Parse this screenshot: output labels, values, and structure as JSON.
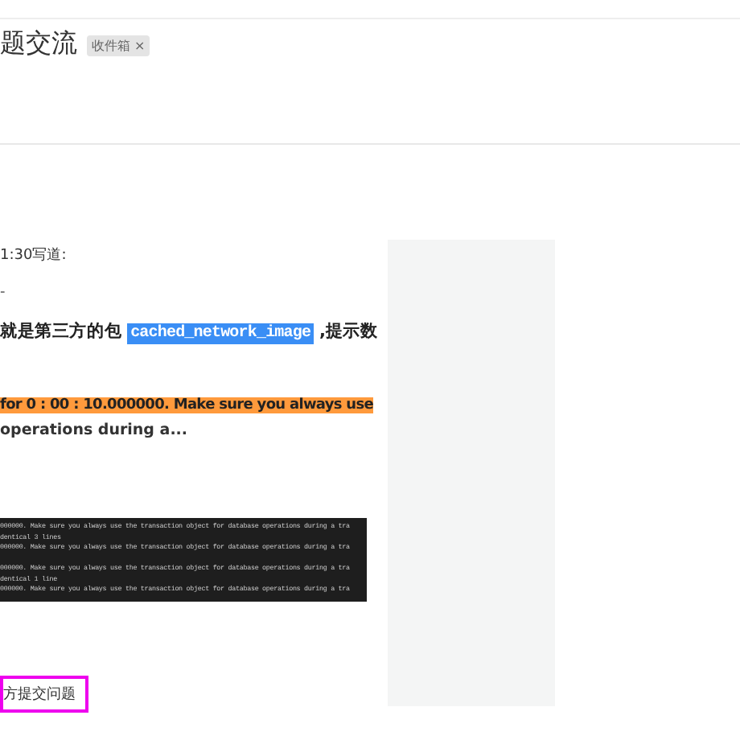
{
  "header": {
    "title": "题交流",
    "tag": {
      "label": "收件箱",
      "close": "×"
    }
  },
  "post": {
    "meta": "1:30写道:",
    "dash": "-",
    "line": {
      "before": "就是第三方的包",
      "code": "cached_network_image",
      "after": ",提示数"
    },
    "highlight": "for 0 : 00 : 10.000000. Make sure you always use",
    "continuation": "operations during a...",
    "terminal": [
      "000000. Make sure you always use the transaction object for database operations during a tra",
      "dentical 3 lines",
      "000000. Make sure you always use the transaction object for database operations during a tra",
      "000000. Make sure you always use the transaction object for database operations during a tra",
      "dentical 1 line",
      "000000. Make sure you always use the transaction object for database operations during a tra"
    ],
    "link": "方提交问题"
  }
}
